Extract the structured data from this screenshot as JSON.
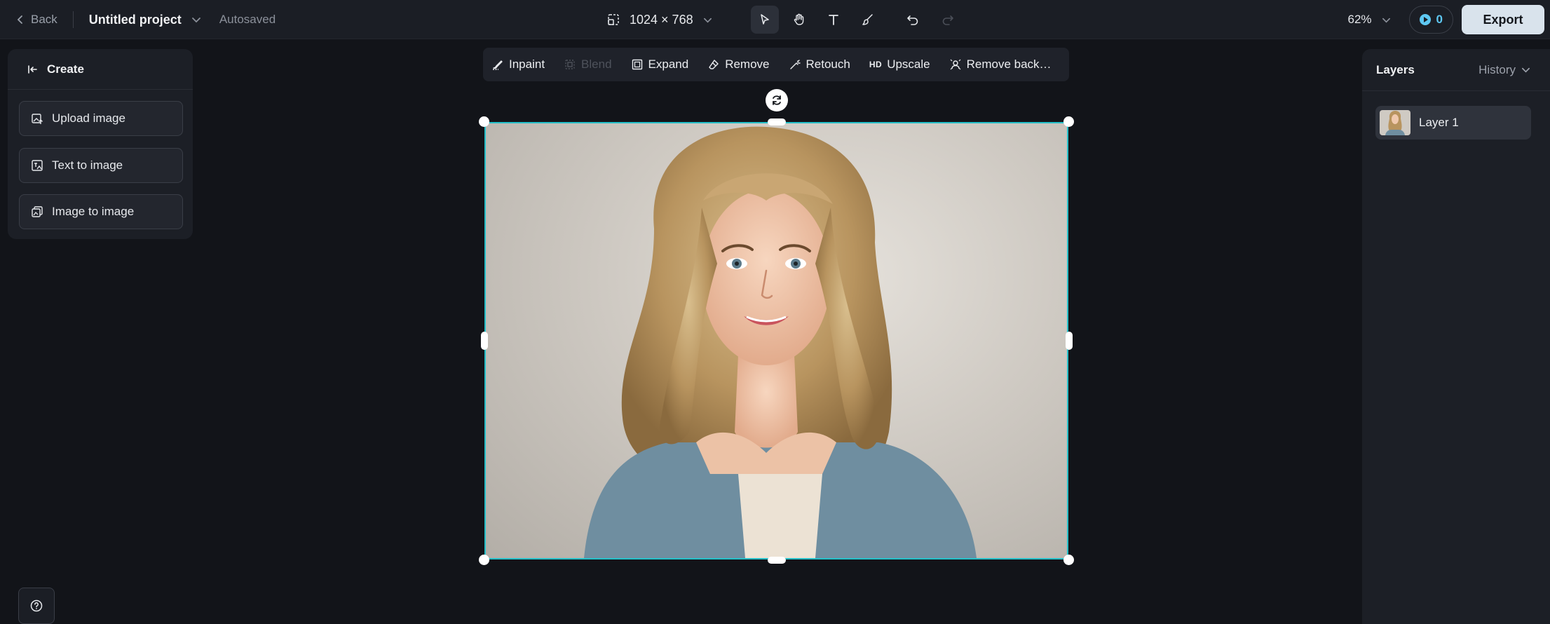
{
  "topbar": {
    "back_label": "Back",
    "project_name": "Untitled project",
    "save_status": "Autosaved",
    "canvas_size": "1024 × 768",
    "zoom": "62%",
    "credits": "0",
    "export_label": "Export"
  },
  "create_panel": {
    "title": "Create",
    "items": [
      {
        "label": "Upload image",
        "icon": "upload-image-icon"
      },
      {
        "label": "Text to image",
        "icon": "text-to-image-icon"
      },
      {
        "label": "Image to image",
        "icon": "image-to-image-icon"
      }
    ]
  },
  "edit_toolbar": {
    "items": [
      {
        "label": "Inpaint",
        "icon": "inpaint-icon",
        "enabled": true
      },
      {
        "label": "Blend",
        "icon": "blend-icon",
        "enabled": false
      },
      {
        "label": "Expand",
        "icon": "expand-icon",
        "enabled": true
      },
      {
        "label": "Remove",
        "icon": "eraser-icon",
        "enabled": true
      },
      {
        "label": "Retouch",
        "icon": "retouch-icon",
        "enabled": true
      },
      {
        "label": "Upscale",
        "badge": "HD",
        "icon": "hd-icon",
        "enabled": true
      },
      {
        "label": "Remove back…",
        "icon": "remove-background-icon",
        "enabled": true
      }
    ]
  },
  "tools": {
    "active": "select",
    "items": [
      "select-arrow-icon",
      "hand-icon",
      "text-tool-icon",
      "brush-icon"
    ],
    "undo_icon": "undo-icon",
    "redo_icon": "redo-icon"
  },
  "layers_panel": {
    "title": "Layers",
    "history_label": "History",
    "layers": [
      {
        "name": "Layer 1"
      }
    ]
  },
  "colors": {
    "background": "#121419",
    "panel": "#1c1f26",
    "selection": "#25c0c9",
    "credits_accent": "#5ec8f2",
    "export_button": "#d9e3ec"
  }
}
